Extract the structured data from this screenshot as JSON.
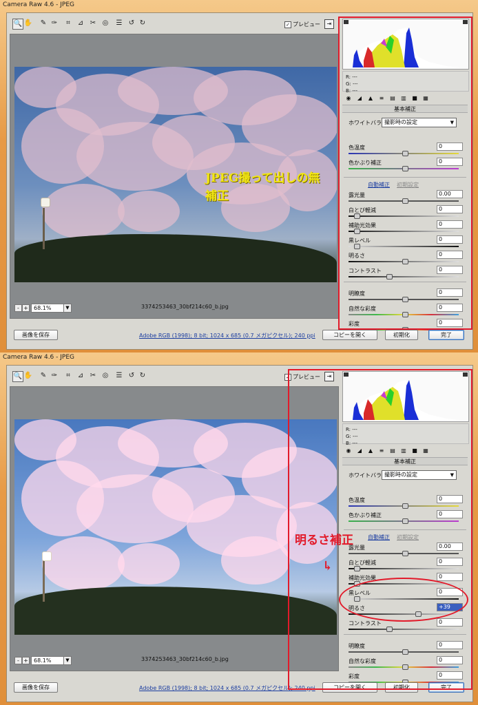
{
  "windows": [
    {
      "title": "Camera Raw 4.6 - JPEG",
      "preview_label": "プレビュー",
      "zoom": "68.1%",
      "filename": "3374253463_30bf214c60_b.jpg",
      "overlay_text": "JPEG撮って出しの無補正",
      "histogram_rgb": {
        "r": "R: ---",
        "g": "G: ---",
        "b": "B: ---"
      },
      "panel_title": "基本補正",
      "wb_label": "ホワイトバランス :",
      "wb_value": "撮影時の設定",
      "auto_label": "自動補正",
      "default_label": "初期設定",
      "sliders": [
        {
          "label": "色温度",
          "value": "0"
        },
        {
          "label": "色かぶり補正",
          "value": "0"
        },
        {
          "label": "露光量",
          "value": "0.00"
        },
        {
          "label": "白とび軽減",
          "value": "0"
        },
        {
          "label": "補助光効果",
          "value": "0"
        },
        {
          "label": "黒レベル",
          "value": "0"
        },
        {
          "label": "明るさ",
          "value": "0"
        },
        {
          "label": "コントラスト",
          "value": "0"
        },
        {
          "label": "明瞭度",
          "value": "0"
        },
        {
          "label": "自然な彩度",
          "value": "0"
        },
        {
          "label": "彩度",
          "value": "0"
        }
      ],
      "slider_levels": [
        0.5,
        0.5,
        0.5,
        0.05,
        0.05,
        0.05,
        0.5,
        0.35,
        0.5,
        0.5,
        0.5
      ],
      "buttons": {
        "save": "画像を保存",
        "open": "コピーを開く",
        "reset": "初期化",
        "done": "完了"
      },
      "info_link": "Adobe RGB (1998); 8 bit; 1024 x 685 (0.7 メガピクセル); 240 ppi"
    },
    {
      "title": "Camera Raw 4.6 - JPEG",
      "preview_label": "プレビュー",
      "zoom": "68.1%",
      "filename": "3374253463_30bf214c60_b.jpg",
      "annotation": "明るさ補正",
      "histogram_rgb": {
        "r": "R: ---",
        "g": "G: ---",
        "b": "B: ---"
      },
      "panel_title": "基本補正",
      "wb_label": "ホワイトバランス :",
      "wb_value": "撮影時の設定",
      "auto_label": "自動補正",
      "default_label": "初期設定",
      "sliders": [
        {
          "label": "色温度",
          "value": "0"
        },
        {
          "label": "色かぶり補正",
          "value": "0"
        },
        {
          "label": "露光量",
          "value": "0.00"
        },
        {
          "label": "白とび軽減",
          "value": "0"
        },
        {
          "label": "補助光効果",
          "value": "0"
        },
        {
          "label": "黒レベル",
          "value": "0"
        },
        {
          "label": "明るさ",
          "value": "+39"
        },
        {
          "label": "コントラスト",
          "value": "0"
        },
        {
          "label": "明瞭度",
          "value": "0"
        },
        {
          "label": "自然な彩度",
          "value": "0"
        },
        {
          "label": "彩度",
          "value": "0"
        }
      ],
      "slider_levels": [
        0.5,
        0.5,
        0.5,
        0.05,
        0.05,
        0.05,
        0.62,
        0.35,
        0.5,
        0.5,
        0.5
      ],
      "buttons": {
        "save": "画像を保存",
        "open": "コピーを開く",
        "reset": "初期化",
        "done": "完了"
      },
      "info_link": "Adobe RGB (1998); 8 bit; 1024 x 685 (0.7 メガピクセル); 240 ppi"
    }
  ],
  "colors": {
    "annotation": "#e21a2a",
    "overlay_text": "#f2e614"
  }
}
